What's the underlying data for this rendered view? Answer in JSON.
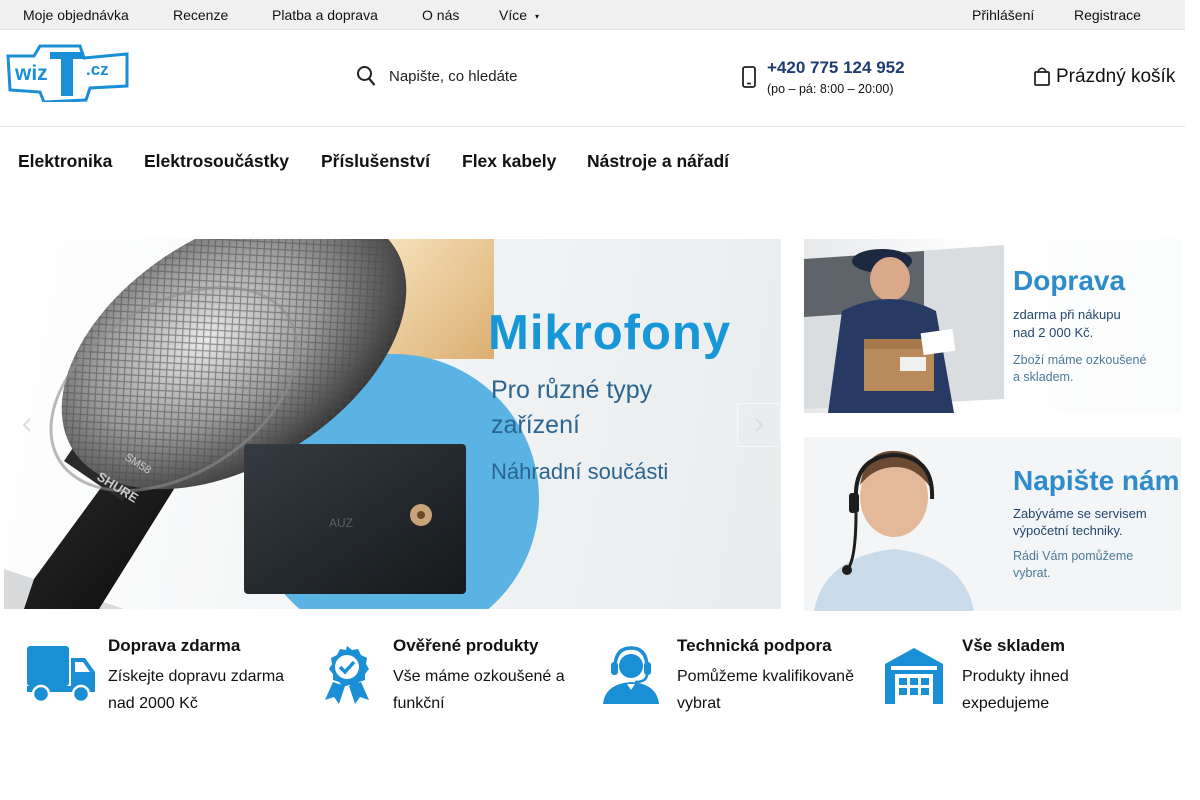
{
  "topbar": {
    "links": [
      "Moje objednávka",
      "Recenze",
      "Platba a doprava",
      "O nás",
      "Více"
    ],
    "more_caret": "▾",
    "login": "Přihlášení",
    "register": "Registrace"
  },
  "logo": {
    "text": "wizIT.cz"
  },
  "search": {
    "placeholder": "Napište, co hledáte",
    "icon": "search-icon"
  },
  "contact": {
    "phone": "+420 775 124 952",
    "hours": "(po – pá: 8:00 – 20:00)",
    "icon": "phone-icon"
  },
  "cart": {
    "label": "Prázdný košík",
    "icon": "cart-icon"
  },
  "categories": [
    "Elektronika",
    "Elektrosoučástky",
    "Příslušenství",
    "Flex kabely",
    "Nástroje a nářadí"
  ],
  "hero": {
    "title": "Mikrofony",
    "subtitle_line1": "Pro různé typy",
    "subtitle_line2": "zařízení",
    "subtitle_line3": "Náhradní součásti",
    "mic_brand": "SHURE",
    "mic_model": "SM58",
    "chip_text": "AUZ",
    "prev_icon": "chevron-left-icon",
    "next_icon": "chevron-right-icon"
  },
  "banners": [
    {
      "title": "Doprava",
      "line1": "zdarma při nákupu",
      "line2": "nad 2 000 Kč.",
      "note1": "Zboží máme ozkoušené",
      "note2": "a skladem.",
      "label_text": ""
    },
    {
      "title": "Napište nám",
      "line1": "Zabýváme se servisem",
      "line2": "výpočetní techniky.",
      "note1": "Rádi Vám pomůžeme",
      "note2": "vybrat."
    }
  ],
  "features": [
    {
      "title": "Doprava zdarma",
      "desc": "Získejte dopravu zdarma nad 2000 Kč",
      "icon": "truck-icon"
    },
    {
      "title": "Ověřené produkty",
      "desc": "Vše máme ozkoušené a funkční",
      "icon": "award-badge-icon"
    },
    {
      "title": "Technická podpora",
      "desc": "Pomůžeme kvalifikovaně vybrat",
      "icon": "support-agent-icon"
    },
    {
      "title": "Vše skladem",
      "desc": "Produkty ihned expedujeme",
      "icon": "warehouse-icon"
    }
  ],
  "colors": {
    "accent_blue": "#1897d8",
    "icon_blue": "#1a8fd6",
    "phone_navy": "#1e3c73",
    "topbar_bg": "#f0f0f0"
  }
}
